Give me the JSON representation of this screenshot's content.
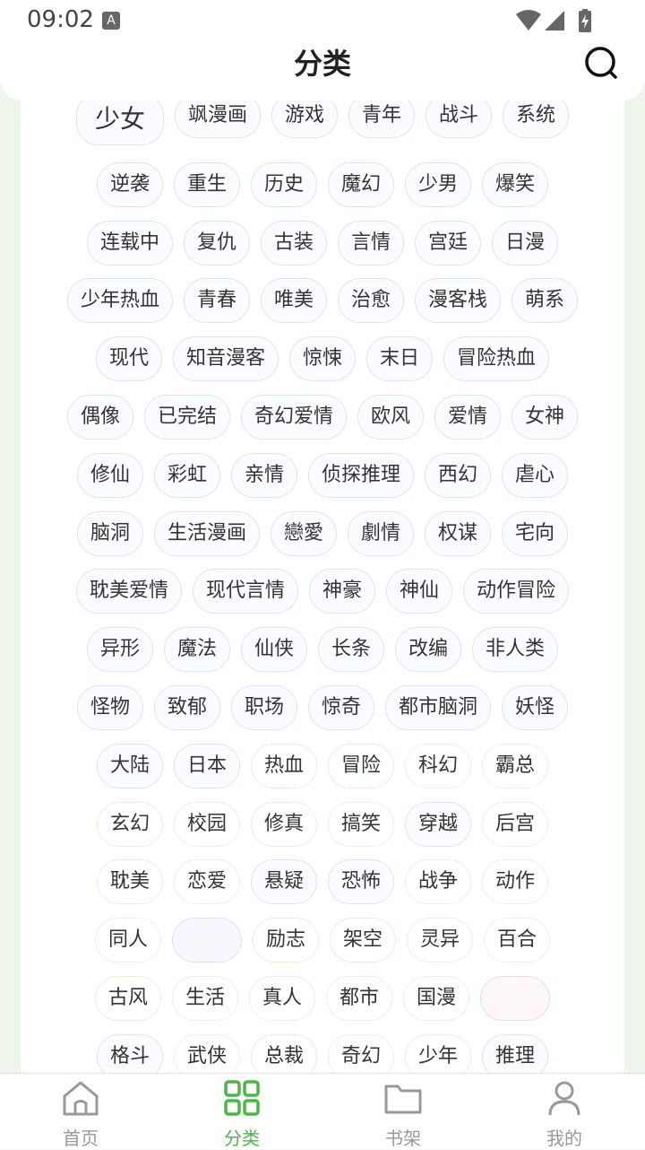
{
  "status": {
    "time": "09:02",
    "notification_icon": "A",
    "icons": [
      "wifi-icon",
      "cell-signal-icon",
      "battery-charging-icon"
    ]
  },
  "header": {
    "title": "分类",
    "search_icon": "search-icon"
  },
  "tag_rows": [
    {
      "tags": [
        {
          "label": "少女",
          "style": "big"
        },
        {
          "label": "飒漫画"
        },
        {
          "label": "游戏"
        },
        {
          "label": "青年"
        },
        {
          "label": "战斗"
        },
        {
          "label": "系统"
        }
      ]
    },
    {
      "tags": [
        {
          "label": "逆袭"
        },
        {
          "label": "重生"
        },
        {
          "label": "历史"
        },
        {
          "label": "魔幻"
        },
        {
          "label": "少男"
        },
        {
          "label": "爆笑"
        }
      ]
    },
    {
      "tags": [
        {
          "label": "连载中"
        },
        {
          "label": "复仇"
        },
        {
          "label": "古装"
        },
        {
          "label": "言情"
        },
        {
          "label": "宫廷"
        },
        {
          "label": "日漫"
        }
      ]
    },
    {
      "tags": [
        {
          "label": "少年热血"
        },
        {
          "label": "青春"
        },
        {
          "label": "唯美"
        },
        {
          "label": "治愈"
        },
        {
          "label": "漫客栈"
        },
        {
          "label": "萌系"
        }
      ]
    },
    {
      "tags": [
        {
          "label": "现代"
        },
        {
          "label": "知音漫客"
        },
        {
          "label": "惊悚"
        },
        {
          "label": "末日"
        },
        {
          "label": "冒险热血"
        }
      ]
    },
    {
      "tags": [
        {
          "label": "偶像"
        },
        {
          "label": "已完结"
        },
        {
          "label": "奇幻爱情"
        },
        {
          "label": "欧风"
        },
        {
          "label": "爱情"
        },
        {
          "label": "女神"
        }
      ]
    },
    {
      "tags": [
        {
          "label": "修仙"
        },
        {
          "label": "彩虹"
        },
        {
          "label": "亲情"
        },
        {
          "label": "侦探推理"
        },
        {
          "label": "西幻"
        },
        {
          "label": "虐心"
        }
      ]
    },
    {
      "tags": [
        {
          "label": "脑洞"
        },
        {
          "label": "生活漫画"
        },
        {
          "label": "戀愛"
        },
        {
          "label": "劇情"
        },
        {
          "label": "权谋"
        },
        {
          "label": "宅向"
        }
      ]
    },
    {
      "tags": [
        {
          "label": "耽美爱情"
        },
        {
          "label": "现代言情"
        },
        {
          "label": "神豪"
        },
        {
          "label": "神仙"
        },
        {
          "label": "动作冒险"
        }
      ]
    },
    {
      "tags": [
        {
          "label": "异形"
        },
        {
          "label": "魔法"
        },
        {
          "label": "仙侠"
        },
        {
          "label": "长条"
        },
        {
          "label": "改编"
        },
        {
          "label": "非人类"
        }
      ]
    },
    {
      "tags": [
        {
          "label": "怪物"
        },
        {
          "label": "致郁"
        },
        {
          "label": "职场"
        },
        {
          "label": "惊奇"
        },
        {
          "label": "都市脑洞"
        },
        {
          "label": "妖怪"
        }
      ]
    },
    {
      "tags": [
        {
          "label": "大陆"
        },
        {
          "label": "日本"
        },
        {
          "label": "热血",
          "style": "soft"
        },
        {
          "label": "冒险",
          "style": "warm"
        },
        {
          "label": "科幻",
          "style": "faded"
        },
        {
          "label": "霸总",
          "style": "faded"
        }
      ]
    },
    {
      "tags": [
        {
          "label": "玄幻",
          "style": "soft"
        },
        {
          "label": "校园",
          "style": "faded"
        },
        {
          "label": "修真",
          "style": "soft"
        },
        {
          "label": "搞笑",
          "style": "faded"
        },
        {
          "label": "穿越"
        },
        {
          "label": "后宫",
          "style": "faded"
        }
      ]
    },
    {
      "tags": [
        {
          "label": "耽美",
          "style": "soft"
        },
        {
          "label": "恋爱",
          "style": "faded"
        },
        {
          "label": "悬疑"
        },
        {
          "label": "恐怖"
        },
        {
          "label": "战争",
          "style": "faded"
        },
        {
          "label": "动作",
          "style": "faded"
        }
      ]
    },
    {
      "tags": [
        {
          "label": "同人",
          "style": "faded"
        },
        {
          "label": "",
          "style": "ghost"
        },
        {
          "label": "励志",
          "style": "soft"
        },
        {
          "label": "架空",
          "style": "warm"
        },
        {
          "label": "灵异",
          "style": "faded"
        },
        {
          "label": "百合",
          "style": "faded"
        }
      ]
    },
    {
      "tags": [
        {
          "label": "古风",
          "style": "soft"
        },
        {
          "label": "生活",
          "style": "faded"
        },
        {
          "label": "真人",
          "style": "faded"
        },
        {
          "label": "都市",
          "style": "faded"
        },
        {
          "label": "国漫",
          "style": "faded"
        },
        {
          "label": "",
          "style": "ghost-pink"
        }
      ]
    },
    {
      "tags": [
        {
          "label": "格斗"
        },
        {
          "label": "武侠",
          "style": "faded"
        },
        {
          "label": "总裁",
          "style": "warm"
        },
        {
          "label": "奇幻",
          "style": "faded"
        },
        {
          "label": "少年",
          "style": "soft"
        },
        {
          "label": "推理"
        }
      ]
    }
  ],
  "bottom_nav": [
    {
      "label": "首页",
      "icon": "home-icon",
      "active": false
    },
    {
      "label": "分类",
      "icon": "grid-icon",
      "active": true
    },
    {
      "label": "书架",
      "icon": "folder-icon",
      "active": false
    },
    {
      "label": "我的",
      "icon": "user-icon",
      "active": false
    }
  ],
  "colors": {
    "accent": "#4bb648",
    "background": "#eef5ea"
  }
}
